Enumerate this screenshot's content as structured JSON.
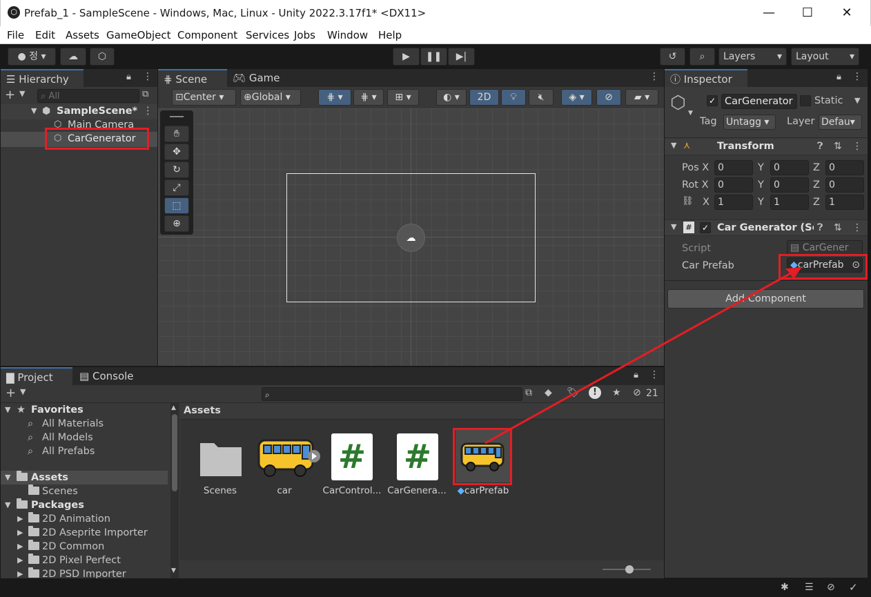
{
  "window": {
    "title": "Prefab_1 - SampleScene - Windows, Mac, Linux - Unity 2022.3.17f1* <DX11>",
    "minimize": "—",
    "maximize": "☐",
    "close": "✕"
  },
  "menu": [
    "File",
    "Edit",
    "Assets",
    "GameObject",
    "Component",
    "Services",
    "Jobs",
    "Window",
    "Help"
  ],
  "toolbar": {
    "account_label": "정",
    "layers_label": "Layers",
    "layout_label": "Layout"
  },
  "hierarchy": {
    "tab_label": "Hierarchy",
    "search_placeholder": "All",
    "scene_name": "SampleScene*",
    "items": [
      "Main Camera",
      "CarGenerator"
    ]
  },
  "scene": {
    "tab_scene": "Scene",
    "tab_game": "Game",
    "pivot": "Center",
    "space": "Global",
    "mode_2d": "2D"
  },
  "inspector": {
    "tab_label": "Inspector",
    "object_name": "CarGenerator",
    "static_label": "Static",
    "tag_label": "Tag",
    "tag_value": "Untagg",
    "layer_label": "Layer",
    "layer_value": "Defau",
    "transform": {
      "title": "Transform",
      "pos_label": "Pos",
      "rot_label": "Rot",
      "pos": {
        "x": "0",
        "y": "0",
        "z": "0"
      },
      "rot": {
        "x": "0",
        "y": "0",
        "z": "0"
      },
      "scale": {
        "x": "1",
        "y": "1",
        "z": "1"
      },
      "axis_x": "X",
      "axis_y": "Y",
      "axis_z": "Z"
    },
    "component": {
      "title": "Car Generator (Scr",
      "script_label": "Script",
      "script_value": "CarGener",
      "prefab_label": "Car Prefab",
      "prefab_value": "carPrefab"
    },
    "add_component": "Add Component"
  },
  "project": {
    "tab_project": "Project",
    "tab_console": "Console",
    "hidden_count": "21",
    "favorites_label": "Favorites",
    "favorites": [
      "All Materials",
      "All Models",
      "All Prefabs"
    ],
    "assets_label": "Assets",
    "asset_children": [
      "Scenes"
    ],
    "packages_label": "Packages",
    "packages": [
      "2D Animation",
      "2D Aseprite Importer",
      "2D Common",
      "2D Pixel Perfect",
      "2D PSD Importer"
    ],
    "breadcrumb": "Assets",
    "grid_items": [
      "Scenes",
      "car",
      "CarControl...",
      "CarGenera...",
      "carPrefab"
    ]
  },
  "colors": {
    "annotation": "#e51d24",
    "accent": "#3a72b0",
    "bus_yellow": "#f6c42a",
    "script_green": "#2d7a2d"
  }
}
